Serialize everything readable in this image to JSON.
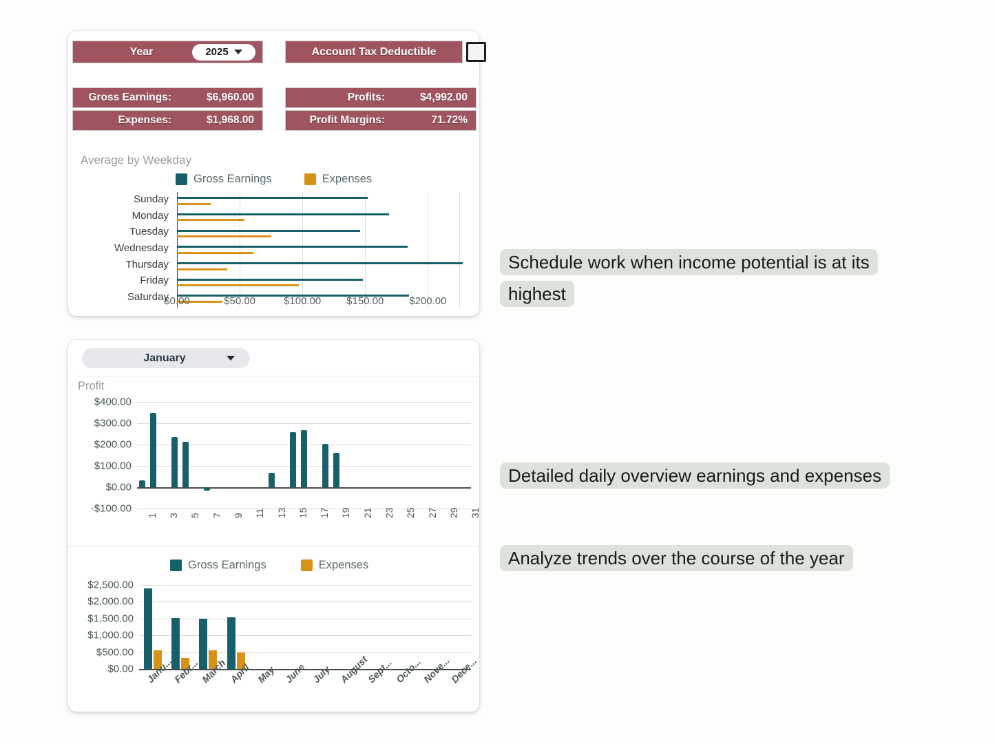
{
  "colors": {
    "maroon": "#a05460",
    "teal": "#17606b",
    "orange": "#d99218",
    "callout_bg": "#dde3da",
    "panel_bg": "#ffffff",
    "page_bg": "#fdfdfc"
  },
  "summary_panel": {
    "year_label": "Year",
    "year_value": "2025",
    "year_caret_icon": "chevron-down-icon",
    "tax_deductible_label": "Account Tax Deductible",
    "tax_deductible_checked": false,
    "kpis_left": [
      {
        "name": "Gross Earnings:",
        "value": "$6,960.00"
      },
      {
        "name": "Expenses:",
        "value": "$1,968.00"
      }
    ],
    "kpis_right": [
      {
        "name": "Profits:",
        "value": "$4,992.00"
      },
      {
        "name": "Profit Margins:",
        "value": "71.72%"
      }
    ]
  },
  "month_panel": {
    "selected_month": "January",
    "caret_icon": "chevron-down-icon",
    "profit_title": "Profit"
  },
  "callouts": [
    {
      "id": "callout-schedule",
      "text": "Schedule work when income potential is at its highest"
    },
    {
      "id": "callout-daily",
      "text": "Detailed daily overview earnings and expenses"
    },
    {
      "id": "callout-trends",
      "text": "Analyze trends over the course of the year"
    }
  ],
  "chart_data": [
    {
      "id": "weekday-chart",
      "type": "bar",
      "orientation": "horizontal",
      "title": "Average by Weekday",
      "xlabel": "",
      "ylabel": "",
      "xlim": [
        0,
        230
      ],
      "xticks": [
        "$0.00",
        "$50.00",
        "$100.00",
        "$150.00",
        "$200.00"
      ],
      "xtick_values": [
        0,
        50,
        100,
        150,
        200
      ],
      "grid": true,
      "legend": [
        "Gross Earnings",
        "Expenses"
      ],
      "legend_position": "top",
      "categories": [
        "Sunday",
        "Monday",
        "Tuesday",
        "Wednesday",
        "Thursday",
        "Friday",
        "Saturday"
      ],
      "series": [
        {
          "name": "Gross Earnings",
          "color": "#17606b",
          "values": [
            152,
            169,
            146,
            184,
            228,
            148,
            185
          ]
        },
        {
          "name": "Expenses",
          "color": "#d99218",
          "values": [
            27,
            54,
            75,
            61,
            40,
            97,
            36
          ]
        }
      ]
    },
    {
      "id": "daily-profit-chart",
      "type": "bar",
      "orientation": "vertical",
      "title": "Profit",
      "xlabel": "",
      "ylabel": "",
      "ylim": [
        -100,
        400
      ],
      "yticks": [
        "$400.00",
        "$300.00",
        "$200.00",
        "$100.00",
        "$0.00",
        "-$100.00"
      ],
      "ytick_values": [
        400,
        300,
        200,
        100,
        0,
        -100
      ],
      "grid": true,
      "categories": [
        "1",
        "2",
        "3",
        "4",
        "5",
        "6",
        "7",
        "8",
        "9",
        "10",
        "11",
        "12",
        "13",
        "14",
        "15",
        "16",
        "17",
        "18",
        "19",
        "20",
        "21",
        "22",
        "23",
        "24",
        "25",
        "26",
        "27",
        "28",
        "29",
        "30",
        "31"
      ],
      "xtick_labels": [
        "1",
        "3",
        "5",
        "7",
        "9",
        "11",
        "13",
        "15",
        "17",
        "19",
        "21",
        "23",
        "25",
        "27",
        "29",
        "31"
      ],
      "series": [
        {
          "name": "Profit",
          "color": "#17606b",
          "values": [
            32,
            348,
            0,
            234,
            214,
            0,
            -16,
            0,
            0,
            0,
            0,
            0,
            68,
            0,
            257,
            268,
            0,
            204,
            161,
            0,
            0,
            0,
            0,
            0,
            0,
            0,
            0,
            0,
            0,
            0,
            0
          ]
        }
      ]
    },
    {
      "id": "monthly-chart",
      "type": "bar",
      "orientation": "vertical",
      "title": "",
      "xlabel": "",
      "ylabel": "",
      "ylim": [
        0,
        2500
      ],
      "yticks": [
        "$2,500.00",
        "$2,000.00",
        "$1,500.00",
        "$1,000.00",
        "$500.00",
        "$0.00"
      ],
      "ytick_values": [
        2500,
        2000,
        1500,
        1000,
        500,
        0
      ],
      "grid": true,
      "legend": [
        "Gross Earnings",
        "Expenses"
      ],
      "legend_position": "top",
      "categories": [
        "Janu...",
        "Febr...",
        "March",
        "April",
        "May",
        "June",
        "July",
        "August",
        "Sept...",
        "Octo...",
        "Nove...",
        "Dece..."
      ],
      "series": [
        {
          "name": "Gross Earnings",
          "color": "#17606b",
          "values": [
            2390,
            1520,
            1490,
            1530,
            0,
            0,
            0,
            0,
            0,
            0,
            0,
            0
          ]
        },
        {
          "name": "Expenses",
          "color": "#d99218",
          "values": [
            550,
            330,
            560,
            490,
            0,
            0,
            0,
            0,
            0,
            0,
            0,
            0
          ]
        }
      ]
    }
  ]
}
